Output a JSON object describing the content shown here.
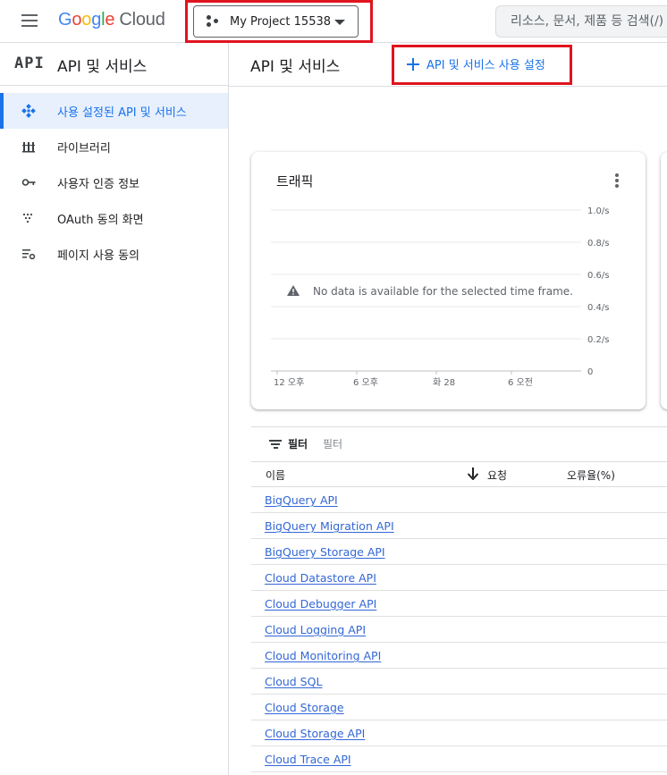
{
  "header": {
    "logo_letters": [
      "G",
      "o",
      "o",
      "g",
      "l",
      "e"
    ],
    "logo_product": "Cloud",
    "project_name": "My Project 15538",
    "search_placeholder": "리소스, 문서, 제품 등 검색(/)"
  },
  "sidebar": {
    "logo_text": "API",
    "title": "API 및 서비스",
    "items": [
      {
        "label": "사용 설정된 API 및 서비스",
        "icon": "diamond-dots-icon",
        "active": true
      },
      {
        "label": "라이브러리",
        "icon": "library-icon",
        "active": false
      },
      {
        "label": "사용자 인증 정보",
        "icon": "key-icon",
        "active": false
      },
      {
        "label": "OAuth 동의 화면",
        "icon": "dots-grid-icon",
        "active": false
      },
      {
        "label": "페이지 사용 동의",
        "icon": "settings-list-icon",
        "active": false
      }
    ]
  },
  "main": {
    "title": "API 및 서비스",
    "enable_button": "API 및 서비스 사용 설정"
  },
  "traffic_card": {
    "title": "트래픽",
    "no_data": "No data is available for the selected time frame."
  },
  "chart_data": {
    "type": "line",
    "title": "트래픽",
    "y_ticks": [
      "1.0/s",
      "0.8/s",
      "0.6/s",
      "0.4/s",
      "0.2/s",
      "0"
    ],
    "x_ticks": [
      "12 오후",
      "6 오후",
      "화 28",
      "6 오전"
    ],
    "ylim": [
      0,
      1.0
    ],
    "series": [],
    "grid": true
  },
  "filter": {
    "label": "필터",
    "placeholder": "필터"
  },
  "table": {
    "columns": {
      "name": "이름",
      "requests": "요청",
      "errors": "오류율(%)"
    },
    "rows": [
      "BigQuery API",
      "BigQuery Migration API",
      "BigQuery Storage API",
      "Cloud Datastore API",
      "Cloud Debugger API",
      "Cloud Logging API",
      "Cloud Monitoring API",
      "Cloud SQL",
      "Cloud Storage",
      "Cloud Storage API",
      "Cloud Trace API"
    ]
  },
  "colors": {
    "accent": "#1a73e8",
    "highlight_box": "#e0141e",
    "active_bg": "#e8f0fe"
  }
}
